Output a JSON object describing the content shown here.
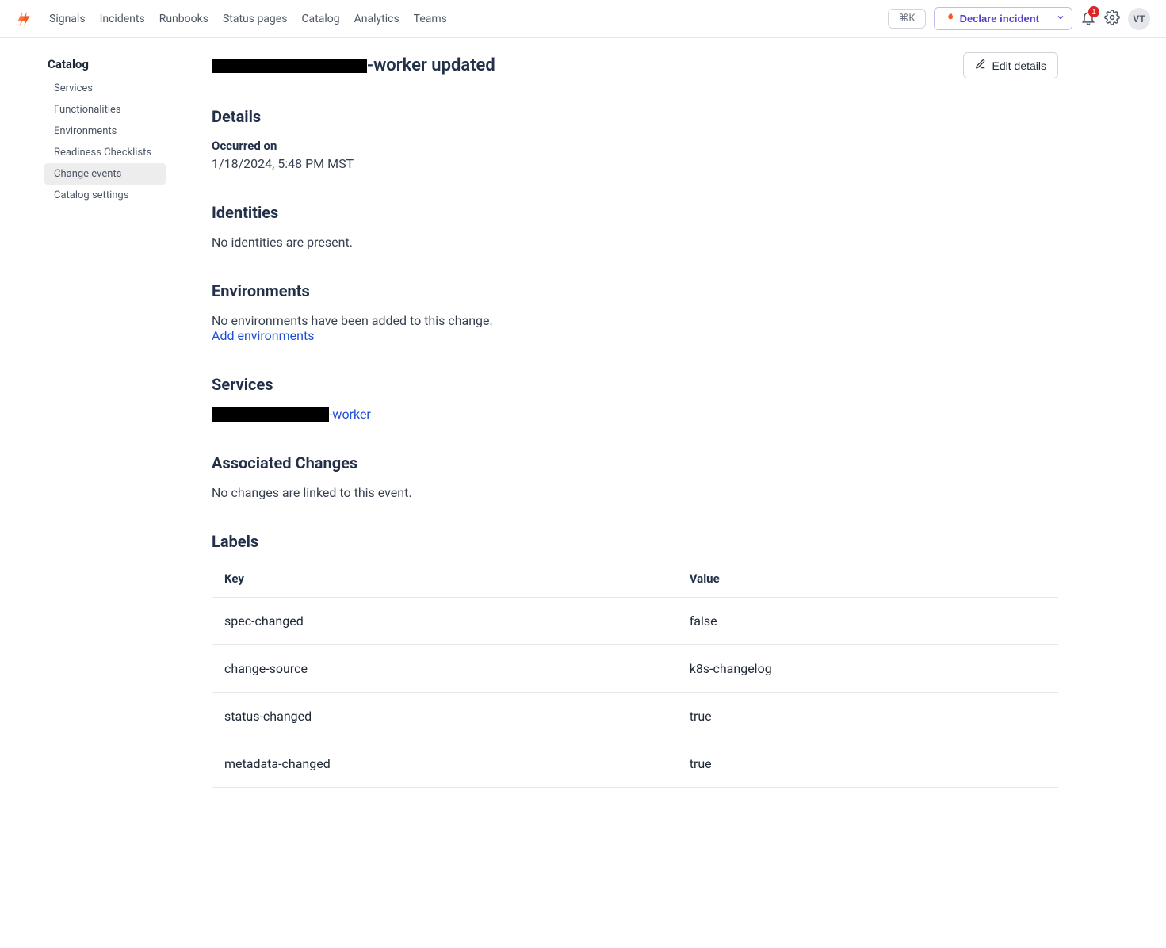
{
  "nav": {
    "links": [
      "Signals",
      "Incidents",
      "Runbooks",
      "Status pages",
      "Catalog",
      "Analytics",
      "Teams"
    ],
    "cmdk": "⌘K",
    "declare_label": "Declare incident",
    "notification_count": "1",
    "avatar_initials": "VT"
  },
  "sidebar": {
    "heading": "Catalog",
    "items": [
      {
        "label": "Services",
        "active": false
      },
      {
        "label": "Functionalities",
        "active": false
      },
      {
        "label": "Environments",
        "active": false
      },
      {
        "label": "Readiness Checklists",
        "active": false
      },
      {
        "label": "Change events",
        "active": true
      },
      {
        "label": "Catalog settings",
        "active": false
      }
    ]
  },
  "page": {
    "title_suffix": "-worker updated",
    "edit_label": "Edit details"
  },
  "details": {
    "heading": "Details",
    "occurred_label": "Occurred on",
    "occurred_value": "1/18/2024, 5:48 PM MST"
  },
  "identities": {
    "heading": "Identities",
    "empty_text": "No identities are present."
  },
  "environments": {
    "heading": "Environments",
    "empty_text": "No environments have been added to this change.",
    "add_link": "Add environments"
  },
  "services": {
    "heading": "Services",
    "items": [
      {
        "suffix": "-worker"
      }
    ]
  },
  "associated": {
    "heading": "Associated Changes",
    "empty_text": "No changes are linked to this event."
  },
  "labels": {
    "heading": "Labels",
    "col_key": "Key",
    "col_value": "Value",
    "rows": [
      {
        "key": "spec-changed",
        "value": "false"
      },
      {
        "key": "change-source",
        "value": "k8s-changelog"
      },
      {
        "key": "status-changed",
        "value": "true"
      },
      {
        "key": "metadata-changed",
        "value": "true"
      }
    ]
  }
}
